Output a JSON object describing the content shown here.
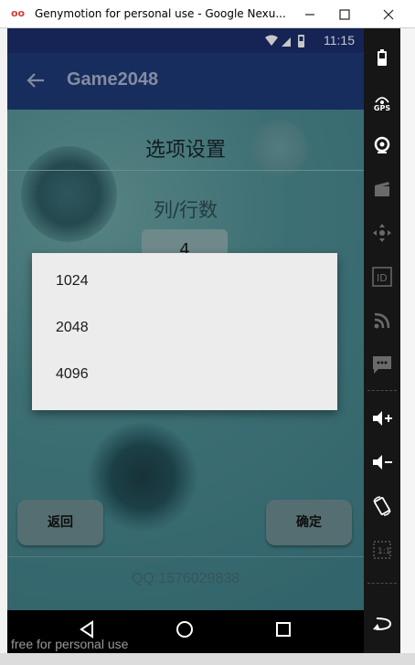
{
  "window": {
    "title": "Genymotion for personal use - Google Nexu...",
    "minimize_icon": "minimize-icon",
    "maximize_icon": "maximize-icon",
    "close_icon": "close-icon"
  },
  "status_bar": {
    "time": "11:15",
    "icons": [
      "wifi-icon",
      "signal-icon",
      "battery-icon"
    ]
  },
  "app_bar": {
    "title": "Game2048",
    "back_icon": "back-arrow-icon"
  },
  "page": {
    "title": "选项设置",
    "section_label": "列/行数",
    "selector_value": "4",
    "back_button": "返回",
    "confirm_button": "确定",
    "footer": "QQ:1576029838"
  },
  "popup": {
    "options": [
      "1024",
      "2048",
      "4096"
    ]
  },
  "nav_bar": {
    "icons": [
      "nav-back-icon",
      "nav-home-icon",
      "nav-recents-icon"
    ]
  },
  "watermark": "free for personal use",
  "sidebar": {
    "gps_label": "GPS",
    "id_label": "ID",
    "icons": [
      "battery-icon",
      "gps-icon",
      "camera-icon",
      "clapperboard-icon",
      "dpad-icon",
      "id-icon",
      "rss-icon",
      "sms-icon",
      "volume-up-icon",
      "volume-down-icon",
      "rotate-icon",
      "scale-icon",
      "back-icon"
    ]
  }
}
